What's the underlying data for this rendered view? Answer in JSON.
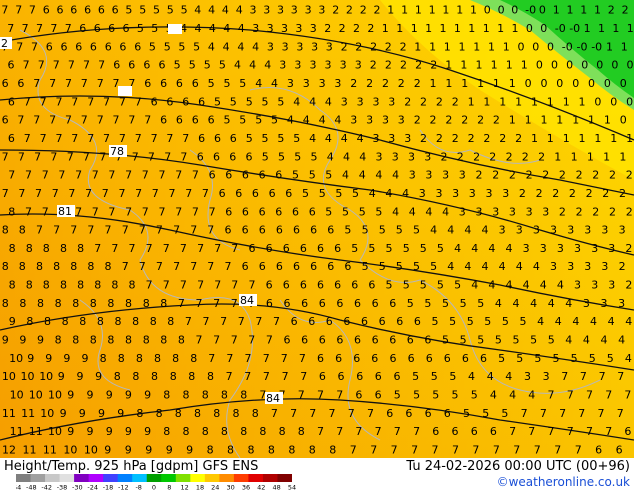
{
  "map": {
    "background_colors": {
      "far_west": "#f7a000",
      "west": "#fbb400",
      "mid": "#fcc800",
      "east": "#fdd600",
      "near_green": "#ffe600",
      "green_zone": "#22cc22",
      "green_edge": "#7ee05a"
    },
    "number_color": "#000000",
    "coastline_color": "#bfbfbf",
    "contour_color": "#111111",
    "contour_labels": [
      {
        "id": "c2",
        "text": "2"
      },
      {
        "id": "c78",
        "text": "78"
      },
      {
        "id": "c81",
        "text": "81"
      },
      {
        "id": "c84a",
        "text": "84"
      },
      {
        "id": "c84b",
        "text": "84"
      }
    ],
    "grid_rows": [
      "7 7 7 6 6 6 6 6 6 5 5 5 5 5 4 4 4 4 3 3 3 3 3 3 2 2 2 2 1 1 1 1 1 1 1 0 0 0 -0 0 1 1 1 1 2 2",
      "7 7 7 7 7 6 6 6 6 5 5 5 4 4 4 4 4 3 3 3 3 3 2 2 2 2 1 1 1 1 1 1 1 1 1 1 0 0 -0 -0 1 1 1 1",
      "7 7 7 6 6 6 6 6 6 6 5 5 5 5 4 4 4 4 3 3 3 3 3 2 2 2 2 2 1 1 1 1 1 1 1 0 0 0 -0 -0 -0 1 1",
      "6 7 7 7 7 7 7 6 6 6 6 5 5 5 5 4 4 4 3 3 3 3 3 3 2 2 2 2 2 1 1 1 1 1 1 0 0 0 0 0 0 0",
      "6 6 7 7 7 7 7 7 7 6 6 6 6 5 5 5 4 4 3 3 3 3 2 2 2 2 2 1 1 1 1 1 1 0 0 0 0 0 0 0",
      "6 7 7 7 7 7 7 7 7 6 6 6 6 5 5 5 5 5 4 4 4 3 3 3 3 2 2 2 2 1 1 1 1 1 1 1 1 0 0 0",
      "6 7 7 7 7 7 7 7 7 7 6 6 6 6 5 5 5 5 4 4 4 4 3 3 3 3 2 2 2 2 2 2 1 1 1 1 1 1 1 0",
      "6 7 7 7 7 7 7 7 7 7 7 7 6 6 6 5 5 5 5 4 4 4 4 3 3 3 2 2 2 2 2 2 2 1 1 1 1 1 1 1",
      "7 7 7 7 7 7 7 7 7 7 7 7 6 6 6 6 5 5 5 5 4 4 4 3 3 3 3 2 2 2 2 2 2 2 1 1 1 1 1",
      "7 7 7 7 7 7 7 7 7 7 7 7 6 6 6 6 6 5 5 5 4 4 4 4 3 3 3 3 2 2 2 2 2 2 2 2 2 2",
      "7 7 7 7 7 7 7 7 7 7 7 7 7 6 6 6 6 6 5 5 5 5 4 4 4 3 3 3 3 3 3 2 2 2 2 2 2 2",
      "8 7 7 7 7 7 7 7 7 7 7 7 7 6 6 6 6 6 6 5 5 5 5 4 4 4 4 3 3 3 3 3 3 2 2 2 2 2",
      "8 8 7 7 7 7 7 7 7 7 7 7 7 6 6 6 6 6 6 6 5 5 5 5 5 4 4 4 4 3 3 3 3 3 3 3 3",
      "8 8 8 8 8 7 7 7 7 7 7 7 7 7 6 6 6 6 6 6 5 5 5 5 5 5 4 4 4 4 3 3 3 3 3 3 2",
      "8 8 8 8 8 8 8 7 7 7 7 7 7 7 6 6 6 6 6 6 6 5 5 5 5 5 4 4 4 4 4 4 3 3 3 3 2",
      "8 8 8 8 8 8 8 8 7 7 7 7 7 7 7 6 6 6 6 6 6 6 5 5 5 5 5 4 4 4 4 4 4 3 3 3 2",
      "8 8 8 8 8 8 8 8 8 8 7 7 7 7 7 6 6 6 6 6 6 6 6 5 5 5 5 5 4 4 4 4 4 3 3 3",
      "9 8 8 8 8 8 8 8 8 8 7 7 7 7 7 7 6 6 6 6 6 6 6 6 5 5 5 5 5 5 4 4 4 4 4 4",
      "9 9 9 8 8 8 8 8 8 8 8 7 7 7 7 7 6 6 6 6 6 6 6 6 6 5 5 5 5 5 5 5 4 4 4 4",
      "10 9 9 9 9 8 8 8 8 8 8 7 7 7 7 7 7 6 6 6 6 6 6 6 6 6 6 5 5 5 5 5 5 5 4",
      "10 10 10 9 9 9 8 8 8 8 8 8 7 7 7 7 7 6 6 6 6 6 5 5 5 4 4 4 3 3 7 7 7 7",
      "10 10 10 9 9 9 9 9 8 8 8 8 8 7 7 7 7 7 6 6 5 5 5 5 5 4 4 4 7 7 7 7 7",
      "11 11 10 9 9 9 9 8 8 8 8 8 8 8 7 7 7 7 7 7 6 6 6 6 5 5 5 7 7 7 7 7 7",
      "11 11 10 9 9 9 9 9 8 8 8 8 8 8 8 8 7 7 7 7 7 7 6 6 6 6 7 7 7 7 7 7 6",
      "12 11 11 10 10 9 9 9 9 9 8 8 8 8 8 8 8 7 7 7 7 7 7 7 7 7 7 7 7 6 6"
    ]
  },
  "footer": {
    "title": "Height/Temp. 925 hPa [gdpm] GFS ENS",
    "date": "Tu 24-02-2026 00:00 UTC (00+96)",
    "credit": "©weatheronline.co.uk",
    "colorbar_ticks": [
      "-54",
      "-48",
      "-42",
      "-38",
      "-30",
      "-24",
      "-18",
      "-12",
      "-8",
      "0",
      "8",
      "12",
      "18",
      "24",
      "30",
      "36",
      "42",
      "48",
      "54"
    ],
    "colorbar_colors": [
      "#7f7f7f",
      "#a0a0a0",
      "#c8c8c8",
      "#e0e0e0",
      "#8000c0",
      "#b000ff",
      "#4040ff",
      "#0080ff",
      "#00c0ff",
      "#00a000",
      "#00c800",
      "#80e000",
      "#ffff00",
      "#ffc800",
      "#ff8c00",
      "#ff3c00",
      "#e00000",
      "#b00000",
      "#800000"
    ]
  }
}
